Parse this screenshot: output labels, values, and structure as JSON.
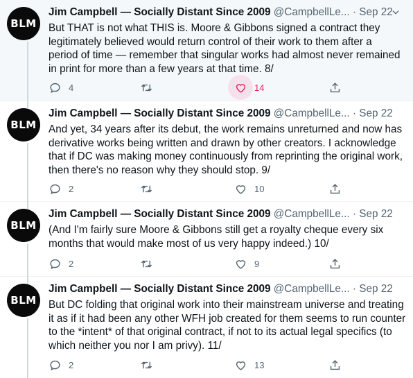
{
  "tweets": [
    {
      "avatar": "BLM",
      "name": "Jim Campbell — Socially Distant Since 2009",
      "handle": "@CampbellLe...",
      "sep": "·",
      "date": "Sep 22",
      "lines": [
        "But THAT is not what THIS is. Moore & Gibbons signed a contract they",
        "legitimately believed would return control of their work to them after a",
        "period of time — remember that singular works had almost never remained",
        "in print for more than a few years at that time. 8/"
      ],
      "replies": "4",
      "retweets": "",
      "likes": "14"
    },
    {
      "avatar": "BLM",
      "name": "Jim Campbell — Socially Distant Since 2009",
      "handle": "@CampbellLe...",
      "sep": "·",
      "date": "Sep 22",
      "lines": [
        "And yet, 34 years after its debut, the work remains unreturned and now has",
        "derivative works being written and drawn by other creators. I acknowledge",
        "that if DC was making money continuously from reprinting the original work,",
        "then there's no reason why they should stop. 9/"
      ],
      "replies": "2",
      "retweets": "",
      "likes": "10"
    },
    {
      "avatar": "BLM",
      "name": "Jim Campbell — Socially Distant Since 2009",
      "handle": "@CampbellLe...",
      "sep": "·",
      "date": "Sep 22",
      "lines": [
        "(And I'm fairly sure Moore & Gibbons still get a royalty cheque every six",
        "months that would make most of us very happy indeed.) 10/"
      ],
      "replies": "2",
      "retweets": "",
      "likes": "9"
    },
    {
      "avatar": "BLM",
      "name": "Jim Campbell — Socially Distant Since 2009",
      "handle": "@CampbellLe...",
      "sep": "·",
      "date": "Sep 22",
      "lines": [
        "But DC folding that original work into their mainstream universe and treating",
        "it as if it had been any other WFH job created for them seems to run counter",
        "to the *intent* of that original contract, if not to its actual legal specifics (to",
        "which neither you nor I am privy). 11/"
      ],
      "replies": "2",
      "retweets": "",
      "likes": "13"
    }
  ],
  "icons": {
    "reply": "reply-icon",
    "retweet": "retweet-icon",
    "like": "heart-icon",
    "share": "share-icon",
    "more": "chevron-down-icon"
  },
  "colors": {
    "highlight_bg": "#f5f8fa",
    "like_active": "#e0245e",
    "muted": "#536471"
  }
}
